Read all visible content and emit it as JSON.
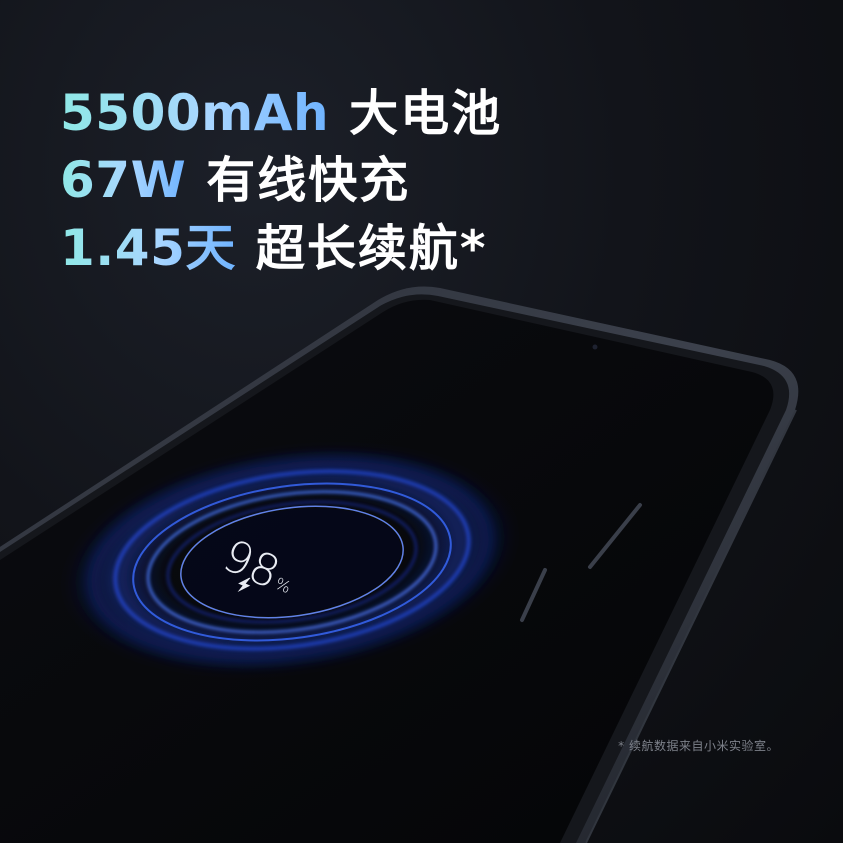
{
  "headline": {
    "lines": [
      {
        "accent": "5500mAh",
        "text": "大电池"
      },
      {
        "accent": "67W",
        "text": "有线快充"
      },
      {
        "accent": "1.45天",
        "text": "超长续航*"
      }
    ]
  },
  "phone_screen": {
    "battery_value": "98",
    "battery_unit": "%",
    "charging_icon": "lightning-bolt-icon"
  },
  "footnote": "* 续航数据来自小米实验室。",
  "colors": {
    "background": "#0a0b0e",
    "accent_start": "#8fe8e6",
    "accent_end": "#6fb3ff",
    "headline_white": "#ffffff",
    "ring_blue": "#2f5bff",
    "footnote_gray": "#7d818a"
  }
}
